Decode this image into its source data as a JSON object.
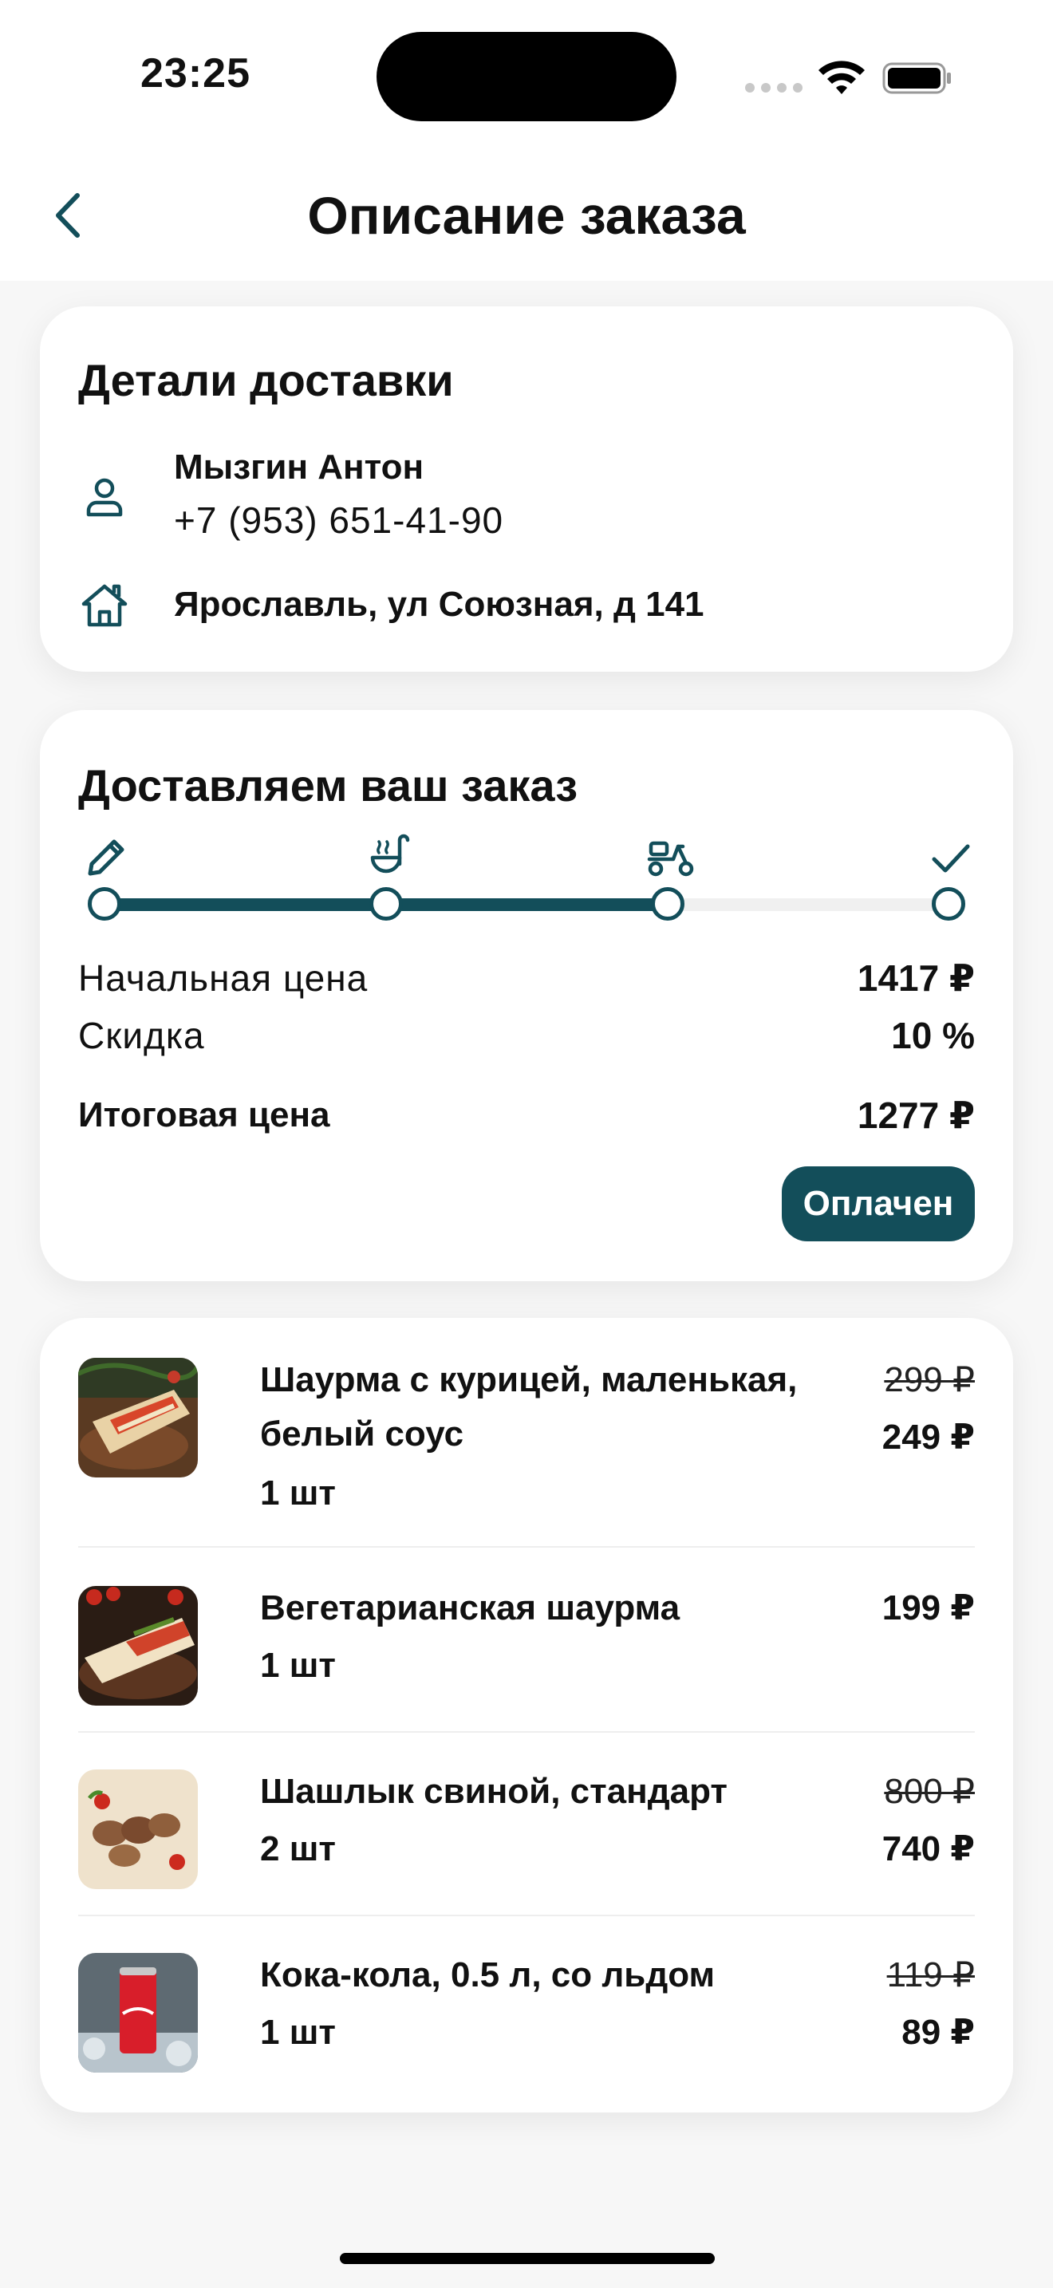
{
  "status_bar": {
    "time": "23:25"
  },
  "header": {
    "title": "Описание заказа"
  },
  "delivery": {
    "title": "Детали доставки",
    "name": "Мызгин Антон",
    "phone": "+7 (953) 651-41-90",
    "address": "Ярославль, ул Союзная, д 141"
  },
  "order_status": {
    "title": "Доставляем ваш заказ",
    "steps": [
      {
        "icon": "pencil-icon"
      },
      {
        "icon": "cooking-pot-icon"
      },
      {
        "icon": "scooter-icon"
      },
      {
        "icon": "checkmark-icon"
      }
    ],
    "progress_step": 3,
    "progress_total_steps": 4,
    "initial_price_label": "Начальная цена",
    "initial_price_value": "1417 ₽",
    "discount_label": "Скидка",
    "discount_value": "10 %",
    "total_label": "Итоговая цена",
    "total_value": "1277 ₽",
    "paid_label": "Оплачен"
  },
  "items": [
    {
      "name": "Шаурма с курицей, маленькая, белый соус",
      "qty": "1 шт",
      "old_price": "299 ₽",
      "price": "249 ₽"
    },
    {
      "name": "Вегетарианская шаурма",
      "qty": "1 шт",
      "old_price": "",
      "price": "199 ₽"
    },
    {
      "name": "Шашлык свиной, стандарт",
      "qty": "2 шт",
      "old_price": "800 ₽",
      "price": "740 ₽"
    },
    {
      "name": "Кока-кола, 0.5 л, со льдом",
      "qty": "1 шт",
      "old_price": "119 ₽",
      "price": "89 ₽"
    }
  ],
  "colors": {
    "accent": "#134e5a",
    "background": "#f7f7f7",
    "card": "#ffffff"
  }
}
